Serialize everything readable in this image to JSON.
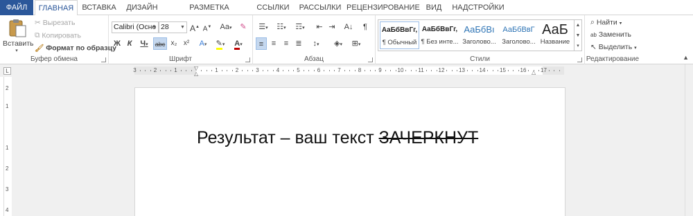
{
  "tabs": [
    {
      "label": "ФАЙЛ"
    },
    {
      "label": "ГЛАВНАЯ"
    },
    {
      "label": "ВСТАВКА"
    },
    {
      "label": "ДИЗАЙН"
    },
    {
      "label": "РАЗМЕТКА СТРАНИЦЫ"
    },
    {
      "label": "ССЫЛКИ"
    },
    {
      "label": "РАССЫЛКИ"
    },
    {
      "label": "РЕЦЕНЗИРОВАНИЕ"
    },
    {
      "label": "ВИД"
    },
    {
      "label": "НАДСТРОЙКИ"
    }
  ],
  "clipboard": {
    "paste": "Вставить",
    "cut": "Вырезать",
    "copy": "Копировать",
    "format_painter": "Формат по образцу",
    "label": "Буфер обмена"
  },
  "font": {
    "name": "Calibri (Осно",
    "size": "28",
    "label": "Шрифт",
    "bold": "Ж",
    "italic": "К",
    "underline": "Ч",
    "strike": "abc",
    "subscript": "x₂",
    "superscript": "x²",
    "grow": "A",
    "shrink": "A",
    "case": "Aa",
    "highlight_color": "#ffff00",
    "font_color": "#c00000"
  },
  "paragraph": {
    "label": "Абзац",
    "pilcrow": "¶"
  },
  "styles": {
    "label": "Стили",
    "items": [
      {
        "preview": "АаБбВвГг,",
        "name": "¶ Обычный"
      },
      {
        "preview": "АаБбВвГг,",
        "name": "¶ Без инте..."
      },
      {
        "preview": "АаБбВı",
        "name": "Заголово..."
      },
      {
        "preview": "АаБбВвГ",
        "name": "Заголово..."
      },
      {
        "preview": "АаБ",
        "name": "Название"
      }
    ]
  },
  "editing": {
    "find": "Найти",
    "replace": "Заменить",
    "select": "Выделить",
    "label": "Редактирование"
  },
  "ruler": {
    "numbers_left": [
      "3",
      "2",
      "1"
    ],
    "numbers_right": [
      "1",
      "2",
      "3",
      "4",
      "5",
      "6",
      "7",
      "8",
      "9",
      "10",
      "11",
      "12",
      "13",
      "14",
      "15",
      "16",
      "17"
    ],
    "vertical": [
      "2",
      "1",
      "1",
      "2",
      "3",
      "4"
    ]
  },
  "document": {
    "text_normal": "Результат – ваш текст ",
    "text_strike": "ЗАЧЕРКНУТ"
  },
  "colors": {
    "accent": "#2b579a",
    "selected": "#c5d8ef"
  }
}
